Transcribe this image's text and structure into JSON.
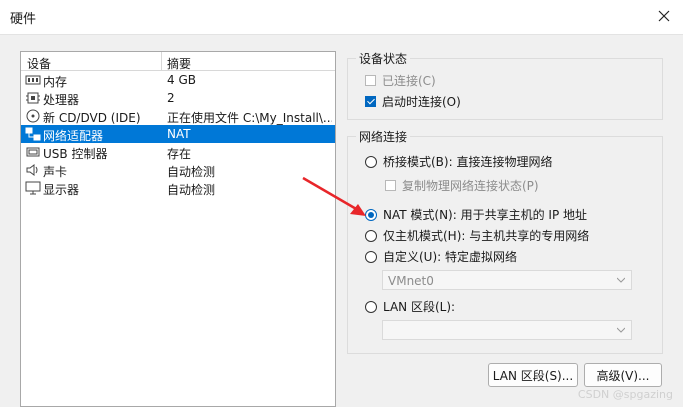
{
  "window": {
    "title": "硬件"
  },
  "device_list": {
    "col_device": "设备",
    "col_summary": "摘要",
    "rows": [
      {
        "icon": "memory-icon",
        "name": "内存",
        "summary": "4 GB",
        "selected": false
      },
      {
        "icon": "processor-icon",
        "name": "处理器",
        "summary": "2",
        "selected": false
      },
      {
        "icon": "cd-dvd-icon",
        "name": "新 CD/DVD (IDE)",
        "summary": "正在使用文件 C:\\My_Install\\...",
        "selected": false
      },
      {
        "icon": "network-adapter-icon",
        "name": "网络适配器",
        "summary": "NAT",
        "selected": true
      },
      {
        "icon": "usb-icon",
        "name": "USB 控制器",
        "summary": "存在",
        "selected": false
      },
      {
        "icon": "sound-icon",
        "name": "声卡",
        "summary": "自动检测",
        "selected": false
      },
      {
        "icon": "display-icon",
        "name": "显示器",
        "summary": "自动检测",
        "selected": false
      }
    ]
  },
  "device_status": {
    "title": "设备状态",
    "connected": {
      "label": "已连接(C)",
      "checked": false,
      "disabled": true
    },
    "connect_at_power_on": {
      "label": "启动时连接(O)",
      "checked": true,
      "disabled": false
    }
  },
  "network_connection": {
    "title": "网络连接",
    "bridged": {
      "label": "桥接模式(B): 直接连接物理网络",
      "checked": false
    },
    "replicate": {
      "label": "复制物理网络连接状态(P)",
      "checked": false,
      "disabled": true
    },
    "nat": {
      "label": "NAT 模式(N): 用于共享主机的 IP 地址",
      "checked": true
    },
    "host_only": {
      "label": "仅主机模式(H): 与主机共享的专用网络",
      "checked": false
    },
    "custom": {
      "label": "自定义(U): 特定虚拟网络",
      "checked": false
    },
    "custom_select": "VMnet0",
    "lan_segment": {
      "label": "LAN 区段(L):",
      "checked": false
    },
    "lan_select": ""
  },
  "buttons": {
    "lan_segments": "LAN 区段(S)...",
    "advanced": "高级(V)..."
  },
  "watermark": "CSDN @spgazing",
  "colors": {
    "selection": "#0078d7",
    "accent": "#0067c0",
    "arrow": "#e8262a"
  }
}
